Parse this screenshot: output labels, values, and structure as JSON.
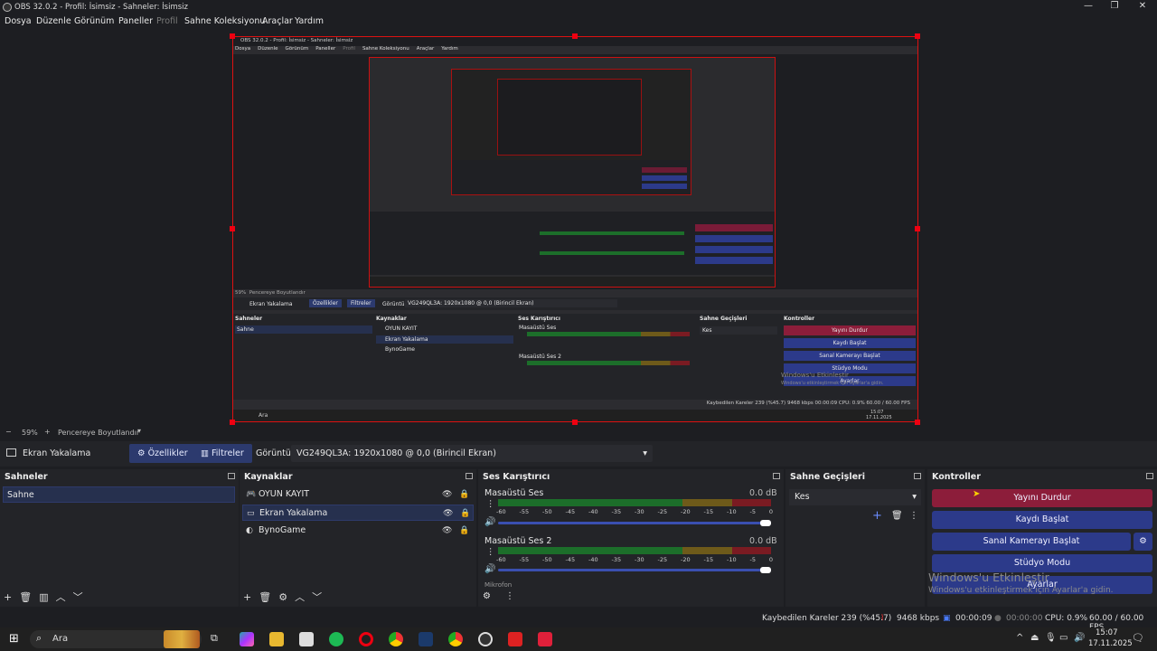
{
  "window": {
    "title": "OBS 32.0.2 - Profil: İsimsiz - Sahneler: İsimsiz",
    "minimize": "—",
    "restore": "❐",
    "close": "✕"
  },
  "menu": [
    "Dosya",
    "Düzenle",
    "Görünüm",
    "Paneller",
    "Profil",
    "Sahne Koleksiyonu",
    "Araçlar",
    "Yardım"
  ],
  "preview": {
    "nested_title": "OBS 32.0.2 - Profil: İsimsiz - Sahneler: İsimsiz",
    "nested_menu": [
      "Dosya",
      "Düzenle",
      "Görünüm",
      "Paneller",
      "Profil",
      "Sahne Koleksiyonu",
      "Araçlar",
      "Yardım"
    ],
    "nested_zoom": "59%",
    "nested_fit": "Pencereye Boyutlandır",
    "nested_source": "Ekran Yakalama",
    "nested_props": "Özellikler",
    "nested_filters": "Filtreler",
    "nested_display_label": "Görüntü",
    "nested_display": "VG249QL3A: 1920x1080 @ 0,0 (Birincil Ekran)",
    "nested_headers": {
      "scenes": "Sahneler",
      "sources": "Kaynaklar",
      "mixer": "Ses Karıştırıcı",
      "transitions": "Sahne Geçişleri",
      "controls": "Kontroller"
    },
    "nested_scene": "Sahne",
    "nested_sources": [
      "OYUN KAYIT",
      "Ekran Yakalama",
      "BynoGame"
    ],
    "nested_mixer": [
      "Masaüstü Ses",
      "Masaüstü Ses 2"
    ],
    "nested_transition": "Kes",
    "nested_controls": [
      "Yayını Durdur",
      "Kaydı Başlat",
      "Sanal Kamerayı Başlat",
      "Stüdyo Modu",
      "Ayarlar"
    ],
    "nested_status": "Kaybedilen Kareler 239 (%45.7)    9468 kbps    00:00:09    CPU: 0.9%    60.00 / 60.00 FPS",
    "nested_search": "Ara",
    "nested_time": "15:07",
    "nested_date": "17.11.2025",
    "nested_wm1": "Windows'u Etkinleştir",
    "nested_wm2": "Windows'u etkinleştirmek için Ayarlar'a gidin."
  },
  "zoom": {
    "minus": "−",
    "value": "59%",
    "plus": "+",
    "fit": "Pencereye Boyutlandır"
  },
  "source_bar": {
    "source": "Ekran Yakalama",
    "properties": "Özellikler",
    "filters": "Filtreler",
    "display_label": "Görüntü",
    "display_value": "VG249QL3A: 1920x1080 @ 0,0 (Birincil Ekran)"
  },
  "scenes": {
    "title": "Sahneler",
    "items": [
      "Sahne"
    ]
  },
  "sources": {
    "title": "Kaynaklar",
    "items": [
      {
        "label": "OYUN KAYIT",
        "icon": "gamepad-icon"
      },
      {
        "label": "Ekran Yakalama",
        "icon": "monitor-icon"
      },
      {
        "label": "BynoGame",
        "icon": "browser-icon"
      }
    ]
  },
  "mixer": {
    "title": "Ses Karıştırıcı",
    "channels": [
      {
        "name": "Masaüstü Ses",
        "db": "0.0 dB",
        "volume": 1.0
      },
      {
        "name": "Masaüstü Ses 2",
        "db": "0.0 dB",
        "volume": 1.0
      }
    ],
    "partial": "Mikrofon",
    "ticks": [
      "-60",
      "-55",
      "-50",
      "-45",
      "-40",
      "-35",
      "-30",
      "-25",
      "-20",
      "-15",
      "-10",
      "-5",
      "0"
    ]
  },
  "transitions": {
    "title": "Sahne Geçişleri",
    "selected": "Kes"
  },
  "controls": {
    "title": "Kontroller",
    "stop_stream": "Yayını Durdur",
    "start_record": "Kaydı Başlat",
    "start_vcam": "Sanal Kamerayı Başlat",
    "studio_mode": "Stüdyo Modu",
    "settings": "Ayarlar"
  },
  "watermark": {
    "line1": "Windows'u Etkinleştir",
    "line2": "Windows'u etkinleştirmek için Ayarlar'a gidin."
  },
  "status": {
    "dropped": "Kaybedilen Kareler 239 (%45.7)",
    "bitrate": "9468 kbps",
    "stream_time": "00:00:09",
    "record_time": "00:00:00",
    "cpu": "CPU: 0.9%",
    "fps": "60.00 / 60.00 FPS"
  },
  "taskbar": {
    "search": "Ara",
    "time": "15:07",
    "date": "17.11.2025"
  },
  "colors": {
    "stop_stream": "#8c1d3a",
    "control_button": "#2c3a8a",
    "selection_border": "#dd1111",
    "meter_green": "#1c6e2a",
    "meter_yellow": "#6e5a1a",
    "meter_red": "#7a1b22"
  }
}
